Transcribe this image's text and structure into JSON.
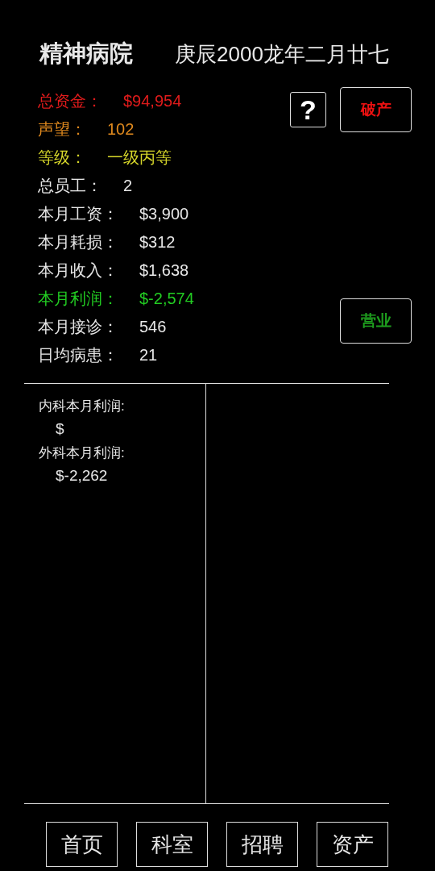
{
  "header": {
    "title": "精神病院",
    "date": "庚辰2000龙年二月廿七"
  },
  "stats": [
    {
      "label": "总资金：",
      "value": "$94,954",
      "color": "#e01b1b"
    },
    {
      "label": "声望：",
      "value": "102",
      "color": "#e08a1e"
    },
    {
      "label": "等级：",
      "value": "一级丙等",
      "color": "#d6d62a"
    },
    {
      "label": "总员工：",
      "value": "2",
      "color": "#e6e6e6"
    },
    {
      "label": "本月工资：",
      "value": "$3,900",
      "color": "#e6e6e6"
    },
    {
      "label": "本月耗损：",
      "value": "$312",
      "color": "#e6e6e6"
    },
    {
      "label": "本月收入：",
      "value": "$1,638",
      "color": "#e6e6e6"
    },
    {
      "label": "本月利润：",
      "value": "$-2,574",
      "color": "#22cc22"
    },
    {
      "label": "本月接诊：",
      "value": "546",
      "color": "#e6e6e6"
    },
    {
      "label": "日均病患：",
      "value": "21",
      "color": "#e6e6e6"
    }
  ],
  "help_button": {
    "label": "?"
  },
  "bankrupt_button": {
    "label": "破产",
    "color": "#ee1111"
  },
  "open_button": {
    "label": "营业",
    "color": "#1e9e1e"
  },
  "department_profits": [
    {
      "label": "内科本月利润:",
      "value": "$"
    },
    {
      "label": "外科本月利润:",
      "value": "$-2,262"
    }
  ],
  "nav": [
    {
      "label": "首页"
    },
    {
      "label": "科室"
    },
    {
      "label": "招聘"
    },
    {
      "label": "资产"
    }
  ]
}
